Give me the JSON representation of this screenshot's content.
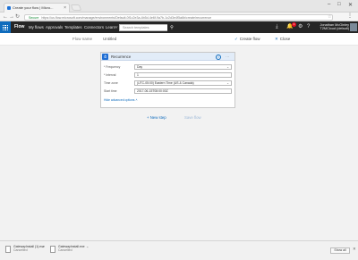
{
  "browser": {
    "tab_title": "Create your flow | Micro...",
    "url": "https://us.flow.microsoft.com/manage/environments/Default-0f1c2e3a-4b5d-4e6f-9a7b-1c2d3e4f5a6b/create/recurrence",
    "secure_label": "Secure",
    "window_controls": [
      "–",
      "□",
      "✕"
    ]
  },
  "app": {
    "brand": "Flow",
    "nav": [
      "My flows",
      "Approvals",
      "Templates",
      "Connectors",
      "Learn"
    ],
    "learn_caret": "˅",
    "search_placeholder": "Search templates",
    "notification_count": "1",
    "user_name": "Jonathan McGinley",
    "user_tenant": "T2MCloud (default)"
  },
  "flow": {
    "name_label": "Flow name",
    "name_value": "Untitled",
    "create_label": "Create flow",
    "close_label": "Close"
  },
  "trigger": {
    "title": "Recurrence",
    "fields": [
      {
        "label": "* Frequency",
        "value": "Day",
        "dropdown": true
      },
      {
        "label": "* Interval",
        "value": "1",
        "dropdown": false
      },
      {
        "label": "Time zone",
        "value": "(UTC-05:00) Eastern Time (US & Canada)",
        "dropdown": true
      },
      {
        "label": "Start time",
        "value": "2017-06-15T08:00:00Z",
        "dropdown": false
      }
    ],
    "advanced_link": "Hide advanced options ˄"
  },
  "actions": {
    "new_step": "+ New step",
    "save_flow": "Save flow"
  },
  "downloads": {
    "items": [
      {
        "name": "GatewayInstall (1).exe",
        "status": "Cancelled"
      },
      {
        "name": "GatewayInstall.exe",
        "status": "Cancelled"
      }
    ],
    "show_all": "Show all"
  },
  "colors": {
    "accent": "#0f6cbd",
    "appbar": "#262626",
    "badge": "#e81123"
  }
}
